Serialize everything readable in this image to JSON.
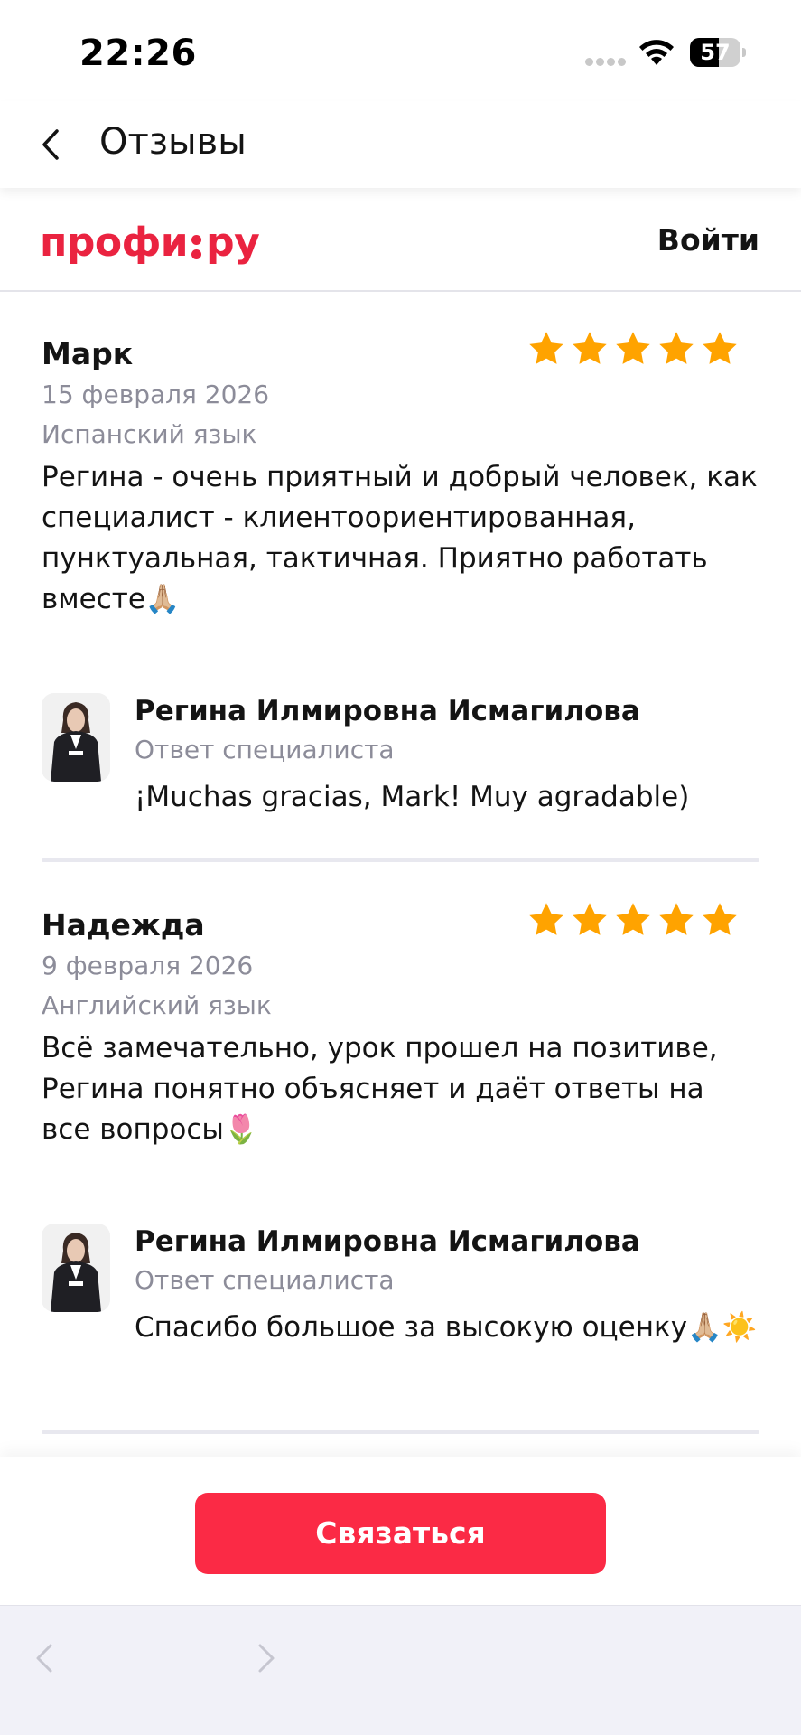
{
  "status_bar": {
    "time": "22:26",
    "battery": "57",
    "battery_level": 0.57
  },
  "header": {
    "title": "Отзывы",
    "back_icon": "chevron-left-icon"
  },
  "site": {
    "logo_left": "профи",
    "logo_right": "ру",
    "login_label": "Войти",
    "brand_color": "#ea2340"
  },
  "reviews": [
    {
      "author": "Марк",
      "rating": 5,
      "date": "15 февраля 2026",
      "subject": "Испанский язык",
      "text": "Регина - очень приятный и добрый человек, как специалист - клиентоориентированная, пунктуальная, тактичная. Приятно работать вместе🙏🏼",
      "reply": {
        "name": "Регина Илмировна Исмагилова",
        "role": "Ответ специалиста",
        "text": "¡Muchas gracias, Mark! Muy agradable)"
      }
    },
    {
      "author": "Надежда",
      "rating": 5,
      "date": "9 февраля 2026",
      "subject": "Английский язык",
      "text": "Всё замечательно, урок прошел на позитиве, Регина понятно объясняет и даёт ответы на все вопросы🌷",
      "reply": {
        "name": "Регина Илмировна Исмагилова",
        "role": "Ответ специалиста",
        "text": "Спасибо большое за высокую оценку🙏🏼☀️"
      }
    }
  ],
  "action": {
    "contact_label": "Связаться",
    "button_color": "#fb2a45"
  },
  "colors": {
    "star": "#ffa300",
    "secondary_text": "#8c8c99"
  }
}
